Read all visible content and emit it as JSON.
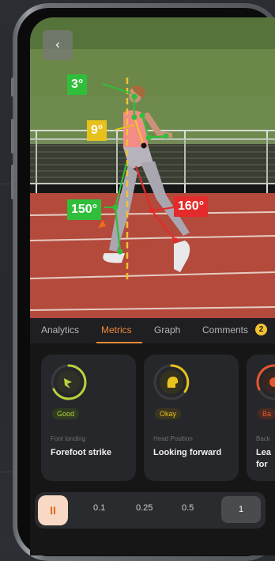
{
  "overlay": {
    "angles": [
      {
        "label": "3°",
        "color": "#2fbf3a"
      },
      {
        "label": "9°",
        "color": "#e8c21c"
      },
      {
        "label": "150°",
        "color": "#2fbf3a"
      },
      {
        "label": "160°",
        "color": "#e32b2b"
      }
    ]
  },
  "tabs": [
    {
      "label": "Analytics"
    },
    {
      "label": "Metrics"
    },
    {
      "label": "Graph"
    },
    {
      "label": "Comments"
    }
  ],
  "comments_count": "2",
  "cards": [
    {
      "status": "Good",
      "subtitle": "Foot landing",
      "title": "Forefoot strike",
      "color": "#b9d23a"
    },
    {
      "status": "Okay",
      "subtitle": "Head Position",
      "title": "Looking forward",
      "color": "#e8c21c"
    },
    {
      "status": "Ba",
      "subtitle": "Back",
      "title": "Lea\nfor",
      "color": "#e8562b"
    }
  ],
  "playback": {
    "pause_icon": "pause-icon",
    "speeds": [
      "0.1",
      "0.25",
      "0.5",
      "1"
    ],
    "selected": "1"
  }
}
